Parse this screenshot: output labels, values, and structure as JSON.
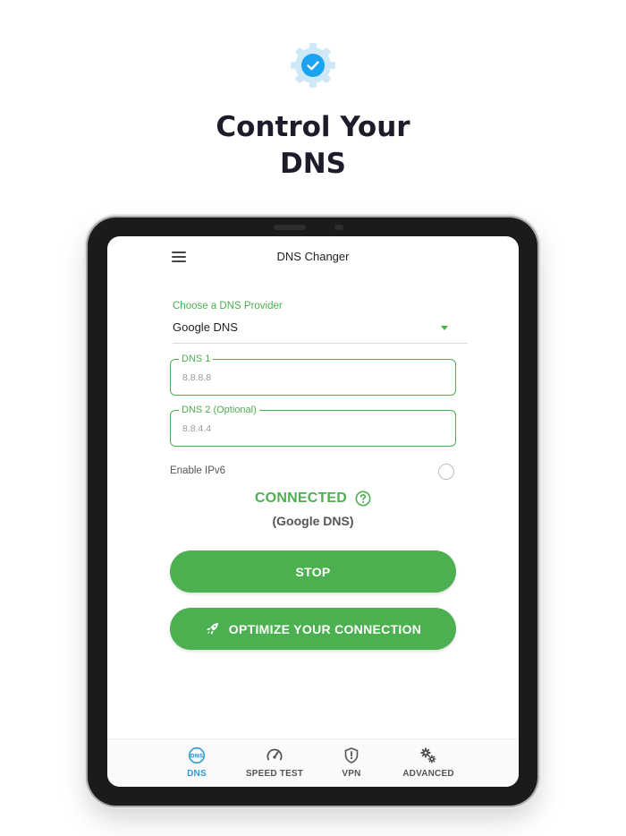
{
  "promo": {
    "headline_line1": "Control Your",
    "headline_line2": "DNS",
    "badge_icon": "verified-gear-icon"
  },
  "app": {
    "title": "DNS Changer",
    "menu_icon": "hamburger-menu-icon"
  },
  "provider": {
    "label": "Choose a DNS Provider",
    "selected": "Google DNS"
  },
  "dns_fields": [
    {
      "label": "DNS 1",
      "value": "8.8.8.8"
    },
    {
      "label": "DNS 2 (Optional)",
      "value": "8.8.4.4"
    }
  ],
  "ipv6": {
    "label": "Enable IPv6",
    "checked": false
  },
  "status": {
    "state": "CONNECTED",
    "provider": "(Google DNS)",
    "help_icon": "question-circle-icon"
  },
  "buttons": {
    "stop": "STOP",
    "optimize": "OPTIMIZE YOUR CONNECTION",
    "optimize_icon": "rocket-icon"
  },
  "bottom_nav": [
    {
      "label": "DNS",
      "icon": "dns-icon",
      "active": true
    },
    {
      "label": "SPEED TEST",
      "icon": "speedometer-icon",
      "active": false
    },
    {
      "label": "VPN",
      "icon": "shield-icon",
      "active": false
    },
    {
      "label": "ADVANCED",
      "icon": "gears-icon",
      "active": false
    }
  ],
  "colors": {
    "accent_green": "#4caf50",
    "active_blue": "#2b9bd6",
    "headline": "#1c1c2a"
  }
}
